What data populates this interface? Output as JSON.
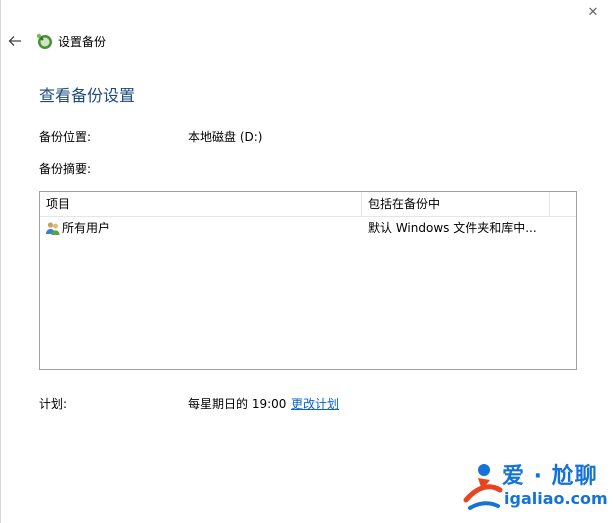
{
  "window": {
    "close_glyph": "✕"
  },
  "titlebar": {
    "title": "设置备份",
    "back_icon": "back-arrow-icon",
    "app_icon": "backup-app-icon"
  },
  "heading": "查看备份设置",
  "backup_location": {
    "label": "备份位置:",
    "value": "本地磁盘 (D:)"
  },
  "backup_summary": {
    "label": "备份摘要:"
  },
  "summary_table": {
    "columns": [
      "项目",
      "包括在备份中"
    ],
    "rows": [
      {
        "item": "所有用户",
        "included": "默认 Windows 文件夹和库中...",
        "icon": "users-icon"
      }
    ]
  },
  "schedule": {
    "label": "计划:",
    "value": "每星期日的 19:00",
    "change_link": "更改计划"
  },
  "watermark": {
    "line1": "爱 · 尬聊",
    "line2": "igaliao.com"
  },
  "colors": {
    "heading": "#1c4a7c",
    "link": "#0a63c9",
    "watermark": "#1573d6",
    "watermark_logo": "#e8451e"
  }
}
